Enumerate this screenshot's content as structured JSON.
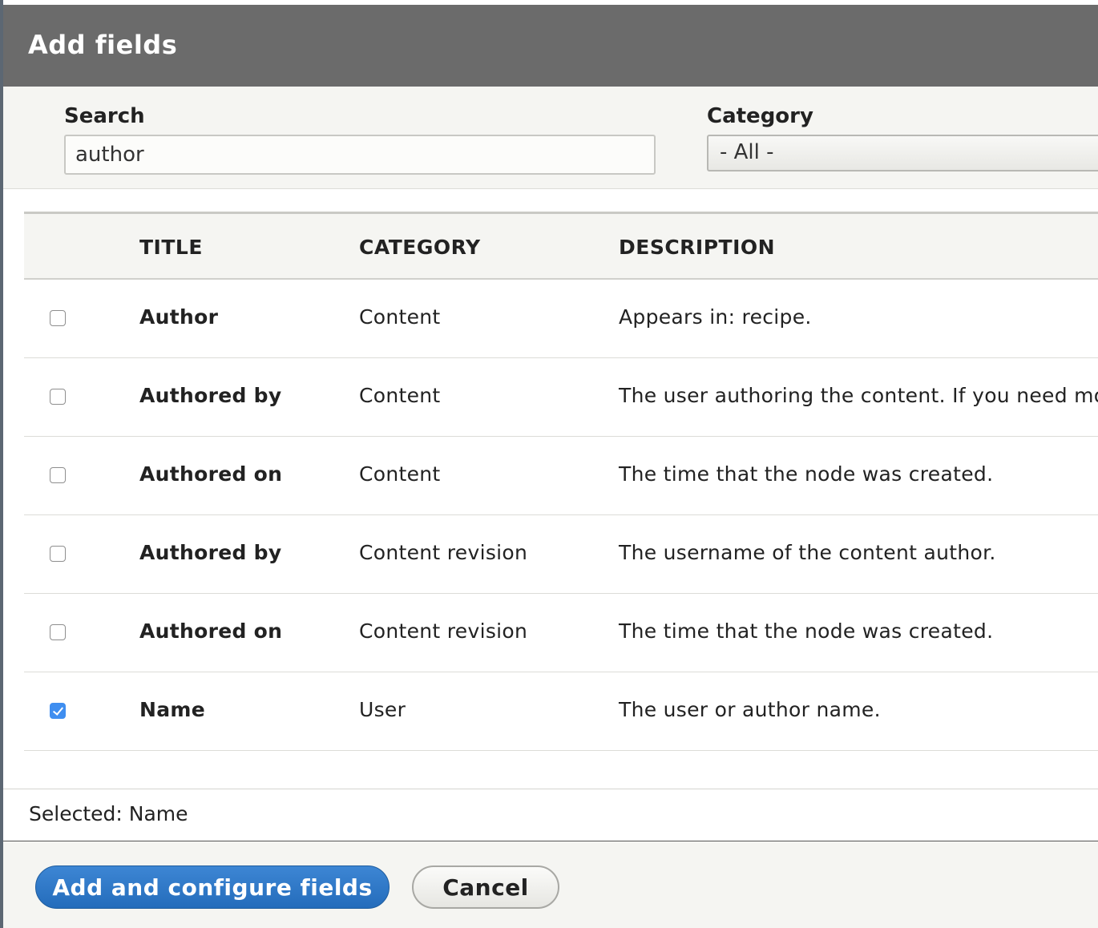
{
  "dialog": {
    "title": "Add fields"
  },
  "filters": {
    "search_label": "Search",
    "search_value": "author",
    "category_label": "Category",
    "category_selected": "- All -"
  },
  "table": {
    "headers": {
      "title": "TITLE",
      "category": "CATEGORY",
      "description": "DESCRIPTION"
    },
    "rows": [
      {
        "checked": false,
        "title": "Author",
        "category": "Content",
        "description": "Appears in: recipe."
      },
      {
        "checked": false,
        "title": "Authored by",
        "category": "Content",
        "description": "The user authoring the content. If you need mo"
      },
      {
        "checked": false,
        "title": "Authored on",
        "category": "Content",
        "description": "The time that the node was created."
      },
      {
        "checked": false,
        "title": "Authored by",
        "category": "Content revision",
        "description": "The username of the content author."
      },
      {
        "checked": false,
        "title": "Authored on",
        "category": "Content revision",
        "description": "The time that the node was created."
      },
      {
        "checked": true,
        "title": "Name",
        "category": "User",
        "description": "The user or author name."
      }
    ]
  },
  "selection": {
    "text": "Selected: Name"
  },
  "buttons": {
    "primary_label": "Add and configure fields",
    "cancel_label": "Cancel"
  },
  "colors": {
    "titlebar": "#6b6b6b",
    "primary_button": "#2f77c8",
    "checkbox_checked": "#3f8ef0"
  }
}
